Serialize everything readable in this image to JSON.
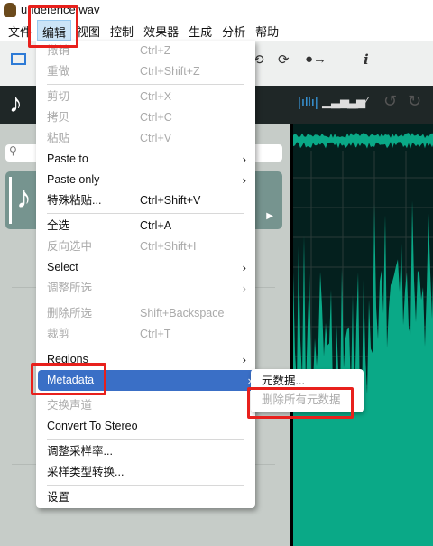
{
  "window": {
    "title": "undefence.wav"
  },
  "menubar": [
    "文件",
    "编辑",
    "视图",
    "控制",
    "效果器",
    "生成",
    "分析",
    "帮助"
  ],
  "search": {
    "placeholder": ""
  },
  "edit_menu": [
    {
      "label": "撤销",
      "shortcut": "Ctrl+Z",
      "disabled": true
    },
    {
      "label": "重做",
      "shortcut": "Ctrl+Shift+Z",
      "disabled": true
    },
    {
      "sep": true
    },
    {
      "label": "剪切",
      "shortcut": "Ctrl+X",
      "disabled": true
    },
    {
      "label": "拷贝",
      "shortcut": "Ctrl+C",
      "disabled": true
    },
    {
      "label": "粘贴",
      "shortcut": "Ctrl+V",
      "disabled": true
    },
    {
      "label": "Paste to",
      "submenu": true
    },
    {
      "label": "Paste only",
      "submenu": true
    },
    {
      "label": "特殊粘贴...",
      "shortcut": "Ctrl+Shift+V"
    },
    {
      "sep": true
    },
    {
      "label": "全选",
      "shortcut": "Ctrl+A"
    },
    {
      "label": "反向选中",
      "shortcut": "Ctrl+Shift+I",
      "disabled": true
    },
    {
      "label": "Select",
      "submenu": true
    },
    {
      "label": "调整所选",
      "submenu": true,
      "disabled": true
    },
    {
      "sep": true
    },
    {
      "label": "删除所选",
      "shortcut": "Shift+Backspace",
      "disabled": true
    },
    {
      "label": "裁剪",
      "shortcut": "Ctrl+T",
      "disabled": true
    },
    {
      "sep": true
    },
    {
      "label": "Regions",
      "submenu": true
    },
    {
      "label": "Metadata",
      "submenu": true,
      "highlighted": true
    },
    {
      "sep": true
    },
    {
      "label": "交换声道",
      "disabled": true
    },
    {
      "label": "Convert To Stereo"
    },
    {
      "sep": true
    },
    {
      "label": "调整采样率..."
    },
    {
      "label": "采样类型转换..."
    },
    {
      "sep": true
    },
    {
      "label": "设置"
    }
  ],
  "metadata_submenu": [
    {
      "label": "元数据...",
      "disabled": false
    },
    {
      "label": "删除所有元数据",
      "disabled": true
    }
  ],
  "colors": {
    "accent": "#3a6fc6",
    "waveform": "#0aa987",
    "highlight": "#e8201c"
  }
}
